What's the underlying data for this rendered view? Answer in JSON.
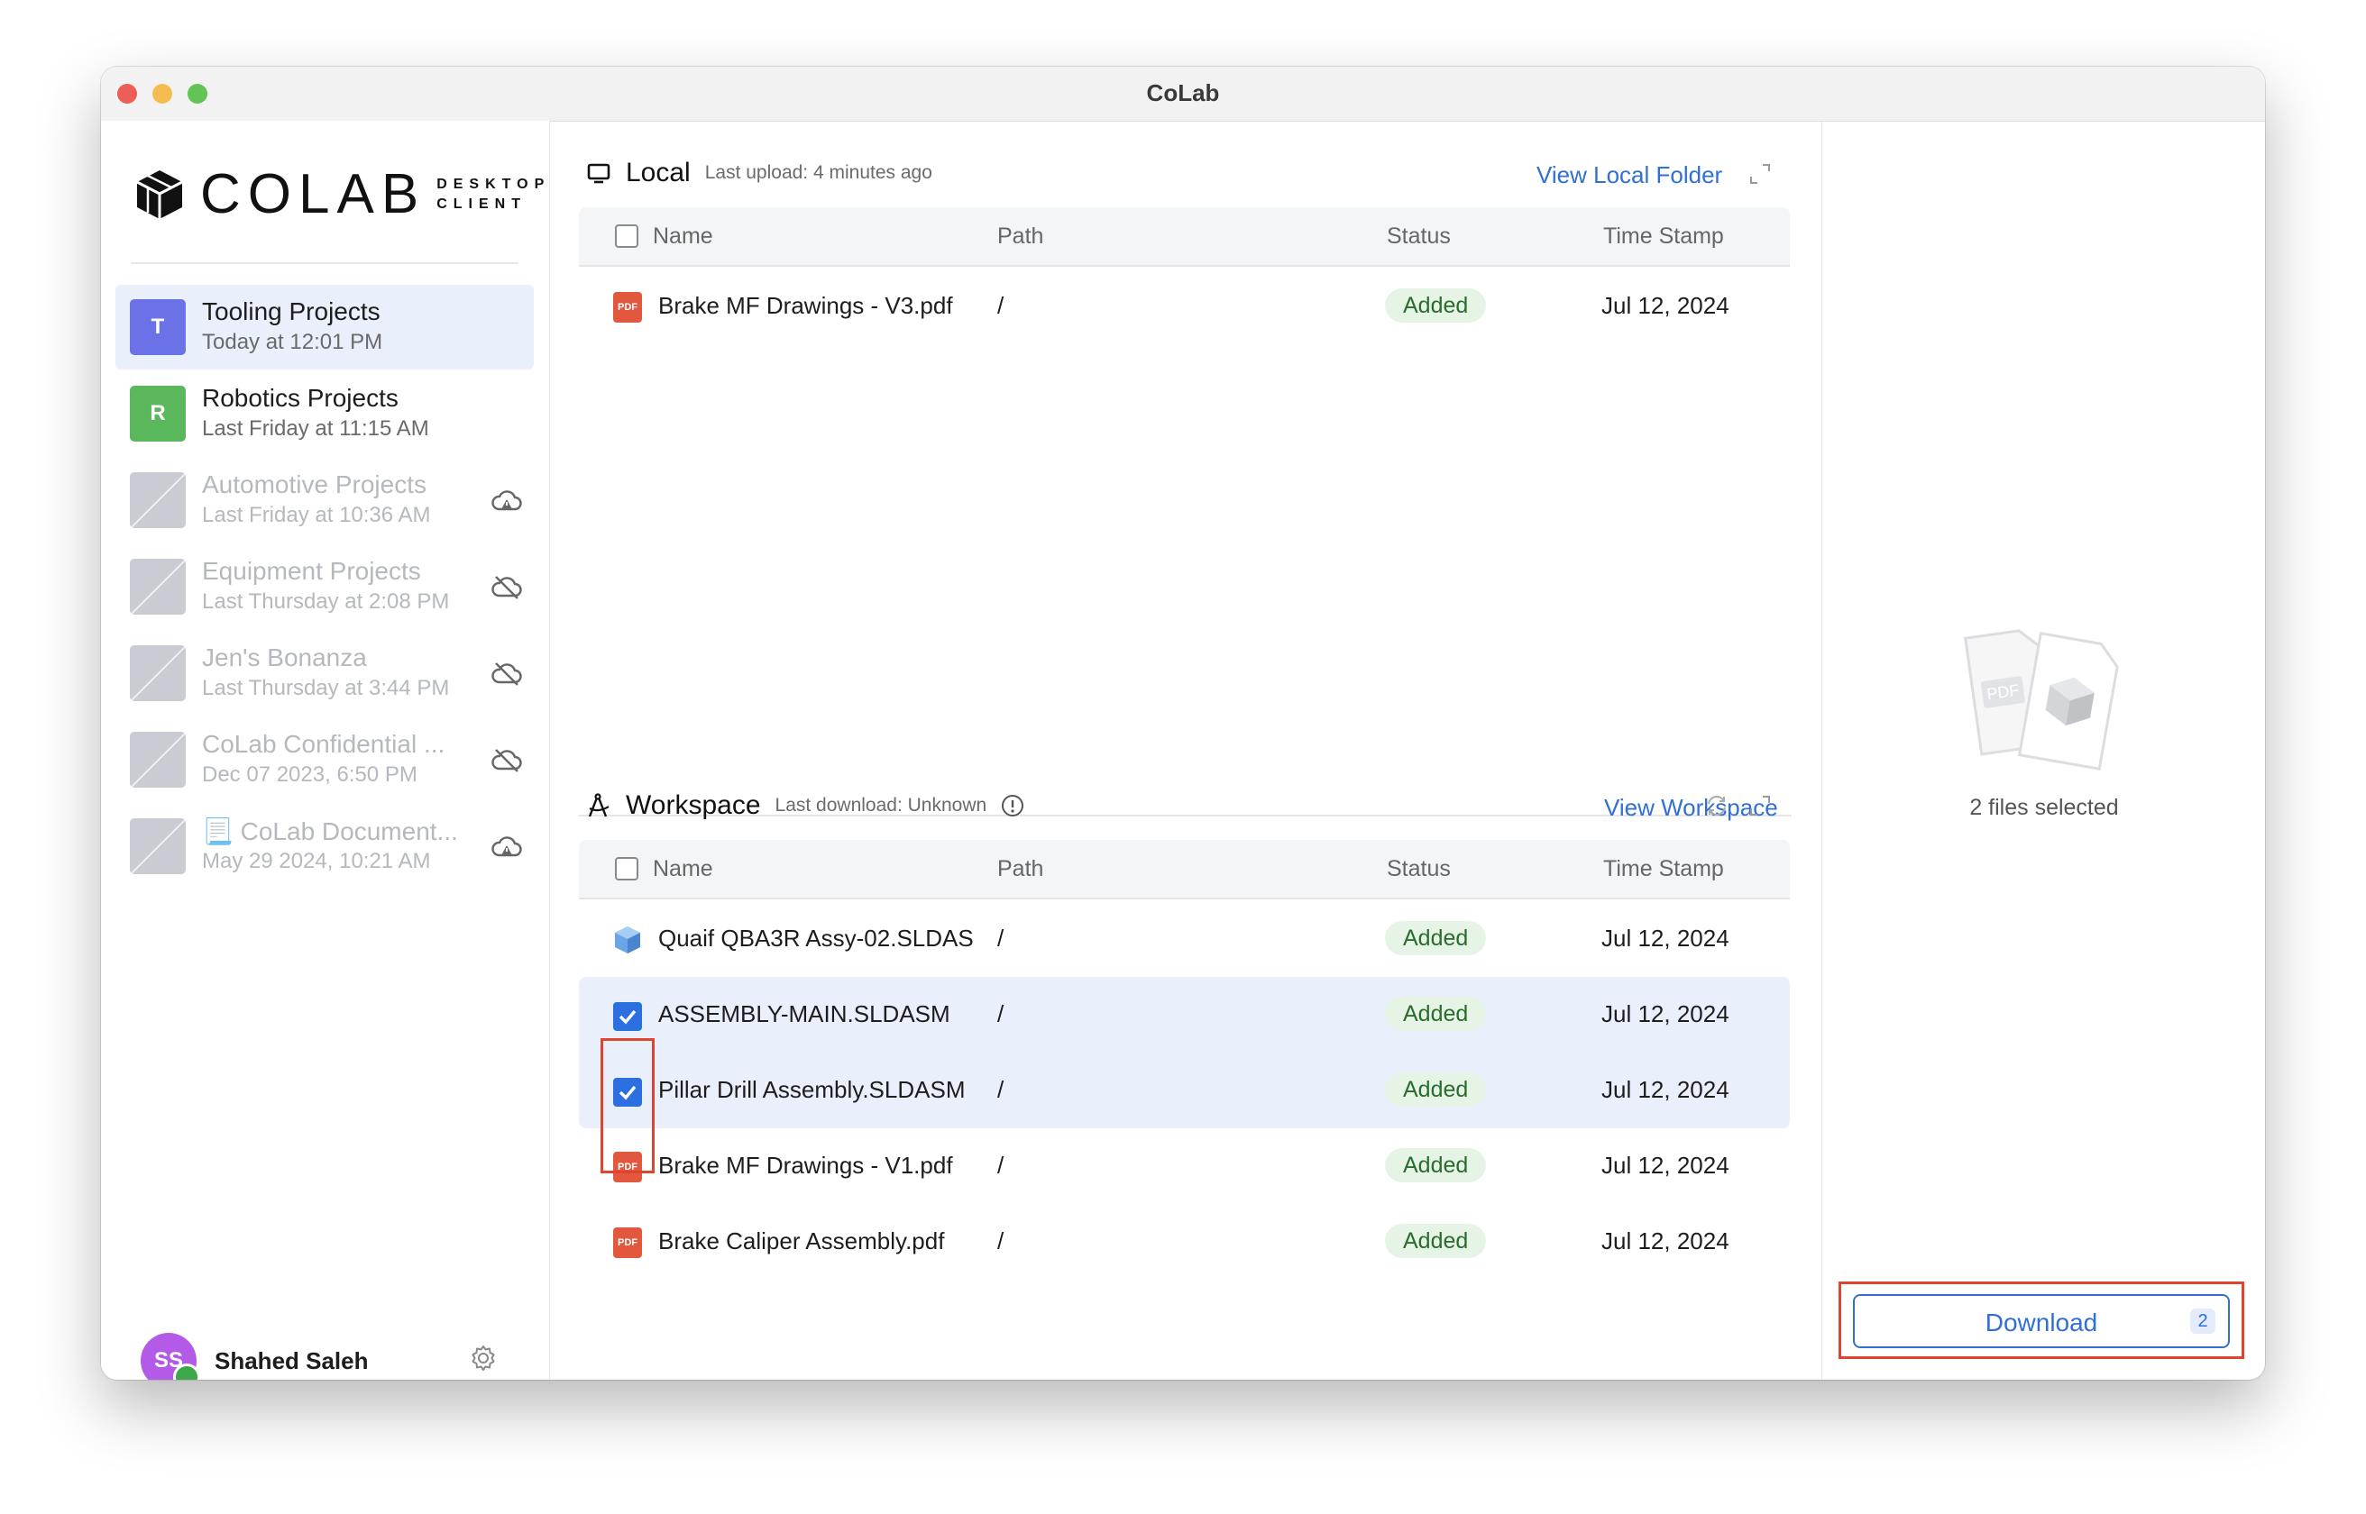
{
  "window": {
    "title": "CoLab"
  },
  "logo": {
    "word": "COLAB",
    "sub_line1": "DESKTOP",
    "sub_line2": "CLIENT"
  },
  "projects": [
    {
      "initial": "T",
      "name": "Tooling Projects",
      "time": "Today at 12:01 PM",
      "color": "#6b72e8",
      "state": "active"
    },
    {
      "initial": "R",
      "name": "Robotics Projects",
      "time": "Last Friday at 11:15 AM",
      "color": "#5bb75c",
      "state": "normal"
    },
    {
      "initial": "",
      "name": "Automotive Projects",
      "time": "Last Friday at 10:36 AM",
      "state": "dim",
      "status_icon": "cloud-warning-icon"
    },
    {
      "initial": "",
      "name": "Equipment Projects",
      "time": "Last Thursday at 2:08 PM",
      "state": "dim",
      "status_icon": "cloud-off-icon"
    },
    {
      "initial": "",
      "name": "Jen's Bonanza",
      "time": "Last Thursday at 3:44 PM",
      "state": "dim",
      "status_icon": "cloud-off-icon"
    },
    {
      "initial": "",
      "name": "CoLab Confidential ...",
      "time": "Dec 07 2023, 6:50 PM",
      "state": "dim",
      "status_icon": "cloud-off-icon"
    },
    {
      "initial": "",
      "name": "📃 CoLab Document...",
      "time": "May 29 2024, 10:21 AM",
      "state": "dim",
      "status_icon": "cloud-warning-icon"
    }
  ],
  "user": {
    "initials": "SS",
    "name": "Shahed Saleh"
  },
  "local": {
    "title": "Local",
    "subtitle": "Last upload: 4 minutes ago",
    "link": "View Local Folder",
    "columns": [
      "Name",
      "Path",
      "Status",
      "Time Stamp"
    ],
    "rows": [
      {
        "type": "pdf",
        "name": "Brake MF Drawings - V3.pdf",
        "path": "/",
        "status": "Added",
        "time": "Jul 12, 2024"
      }
    ]
  },
  "workspace": {
    "title": "Workspace",
    "subtitle": "Last download: Unknown",
    "link": "View Workspace",
    "columns": [
      "Name",
      "Path",
      "Status",
      "Time Stamp"
    ],
    "rows": [
      {
        "type": "cad",
        "name": "Quaif QBA3R Assy-02.SLDASM",
        "path": "/",
        "status": "Added",
        "time": "Jul 12, 2024",
        "checked": false
      },
      {
        "type": "cad",
        "name": "ASSEMBLY-MAIN.SLDASM",
        "path": "/",
        "status": "Added",
        "time": "Jul 12, 2024",
        "checked": true
      },
      {
        "type": "cad",
        "name": "Pillar Drill Assembly.SLDASM",
        "path": "/",
        "status": "Added",
        "time": "Jul 12, 2024",
        "checked": true
      },
      {
        "type": "pdf",
        "name": "Brake MF Drawings - V1.pdf",
        "path": "/",
        "status": "Added",
        "time": "Jul 12, 2024",
        "checked": false
      },
      {
        "type": "pdf",
        "name": "Brake Caliper Assembly.pdf",
        "path": "/",
        "status": "Added",
        "time": "Jul 12, 2024",
        "checked": false
      }
    ]
  },
  "selection": {
    "label": "2 files selected",
    "pdf_badge": "PDF"
  },
  "download": {
    "label": "Download",
    "count": "2"
  },
  "colors": {
    "accent": "#2f6fd6",
    "highlight": "#e0442f",
    "status_green": "#2a6b2e"
  }
}
